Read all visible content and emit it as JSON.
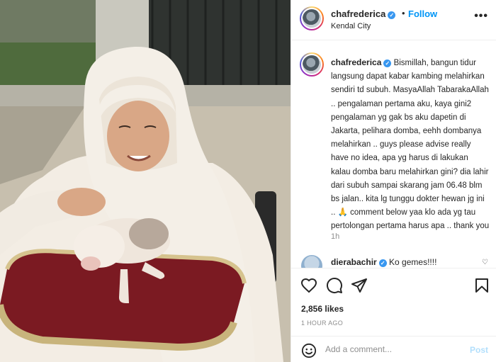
{
  "header": {
    "username": "chafrederica",
    "separator": "•",
    "follow_label": "Follow",
    "location": "Kendal City",
    "more_label": "•••"
  },
  "caption": {
    "username": "chafrederica",
    "text": "Bismillah, bangun tidur langsung dapat kabar kambing melahirkan sendiri td subuh. MasyaAllah TabarakaAllah .. pengalaman pertama aku, kaya gini2 pengalaman yg gak bs aku dapetin di Jakarta, pelihara domba, eehh dombanya melahirkan .. guys please advise really have no idea, apa yg harus di lakukan kalau domba baru melahirkan gini? dia lahir dari subuh sampai skarang jam 06.48 blm bs jalan.. kita lg tunggu dokter hewan jg ini .. 🙏 comment below yaa klo ada yg tau pertolongan pertama harus apa .. thank you",
    "time": "1h"
  },
  "comment": {
    "username": "dierabachir",
    "text": "Ko gemes!!!!"
  },
  "icons": {
    "verified": "verified-badge-icon",
    "like": "heart-icon",
    "comment": "comment-bubble-icon",
    "share": "paper-plane-icon",
    "save": "bookmark-icon",
    "emoji": "smiley-icon"
  },
  "stats": {
    "likes": "2,856 likes",
    "ago": "1 HOUR AGO"
  },
  "add_comment": {
    "placeholder": "Add a comment...",
    "post_label": "Post"
  },
  "colors": {
    "accent": "#0095f6",
    "verified": "#3897f0",
    "muted": "#8e8e8e",
    "post_disabled": "#b2dffc"
  }
}
